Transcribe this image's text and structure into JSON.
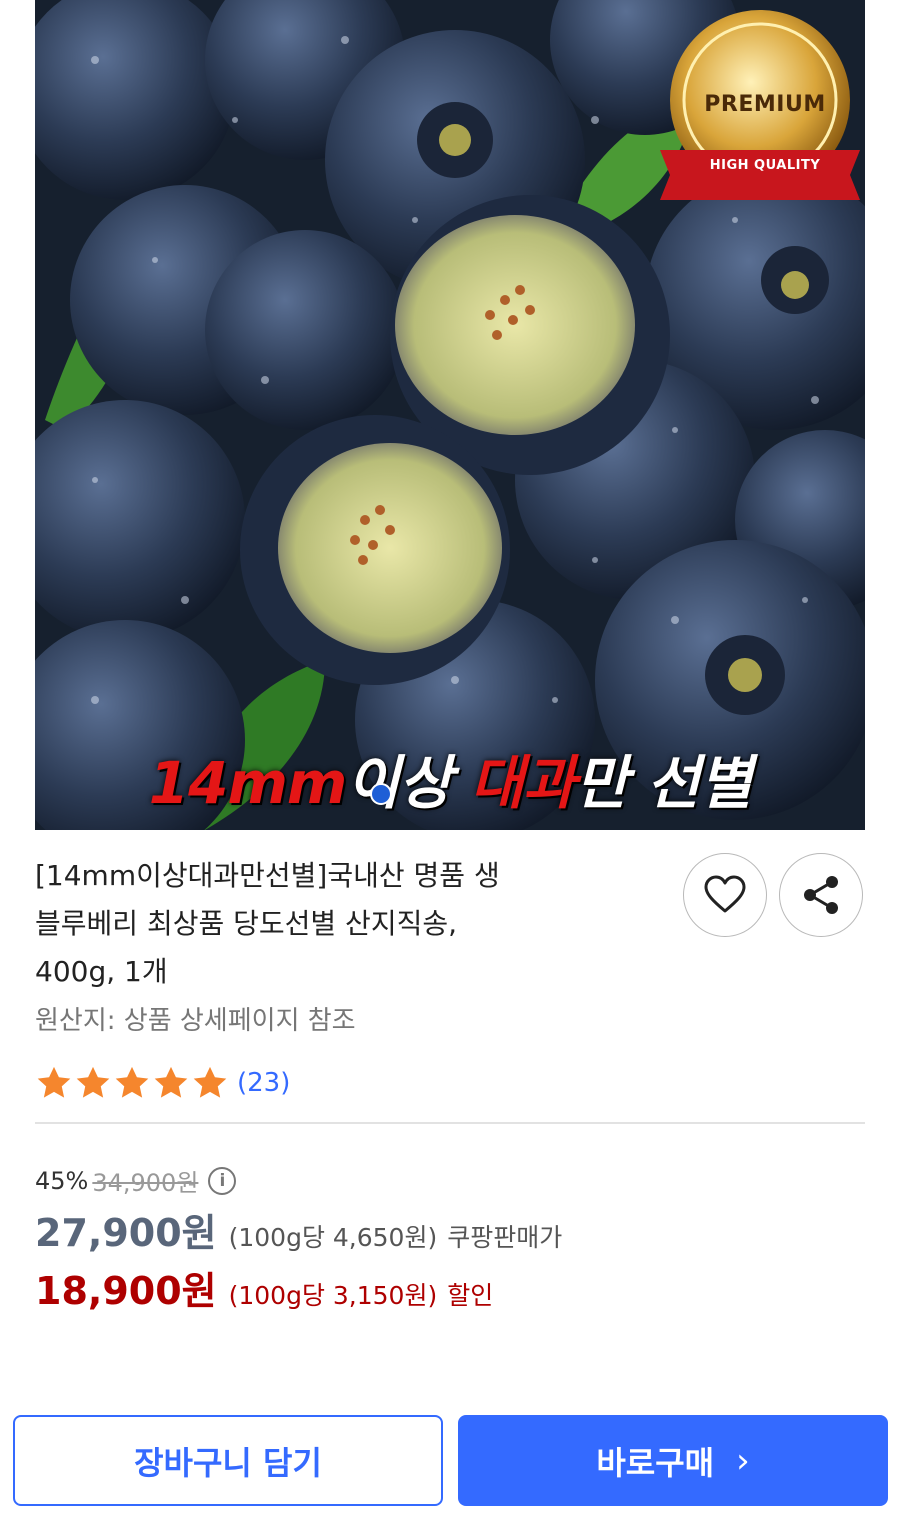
{
  "product_image": {
    "badge_title": "PREMIUM",
    "badge_ribbon": "HIGH QUALITY",
    "banner": {
      "part1": "14mm",
      "part2": "이상 ",
      "part3": "대과",
      "part4": "만 선별"
    },
    "colors": {
      "background": "#16202e",
      "berry": "#2c3b55",
      "leaf": "#3d8a2e",
      "badge_gold": "#d9a53a",
      "ribbon_red": "#c8161d"
    }
  },
  "product": {
    "title_line1": "[14mm이상대과만선별]국내산 명품 생",
    "title_line2": "블루베리 최상품 당도선별 산지직송,",
    "title_line3": "400g, 1개",
    "origin": "원산지: 상품 상세페이지 참조",
    "rating": 5,
    "review_count": "(23)"
  },
  "actions": {
    "favorite_icon": "heart-icon",
    "share_icon": "share-icon"
  },
  "pricing": {
    "discount_rate": "45%",
    "original_price": "34,900원",
    "info_icon": "i",
    "coupang_price": "27,900원",
    "coupang_unit_price": "(100g당 4,650원)",
    "coupang_tag": "쿠팡판매가",
    "sale_price": "18,900원",
    "sale_unit_price": "(100g당 3,150원)",
    "sale_tag": "할인",
    "accent_color": "#346aff",
    "sale_color": "#ae0000"
  },
  "buttons": {
    "cart": "장바구니 담기",
    "buy": "바로구매",
    "buy_chevron": "›"
  }
}
